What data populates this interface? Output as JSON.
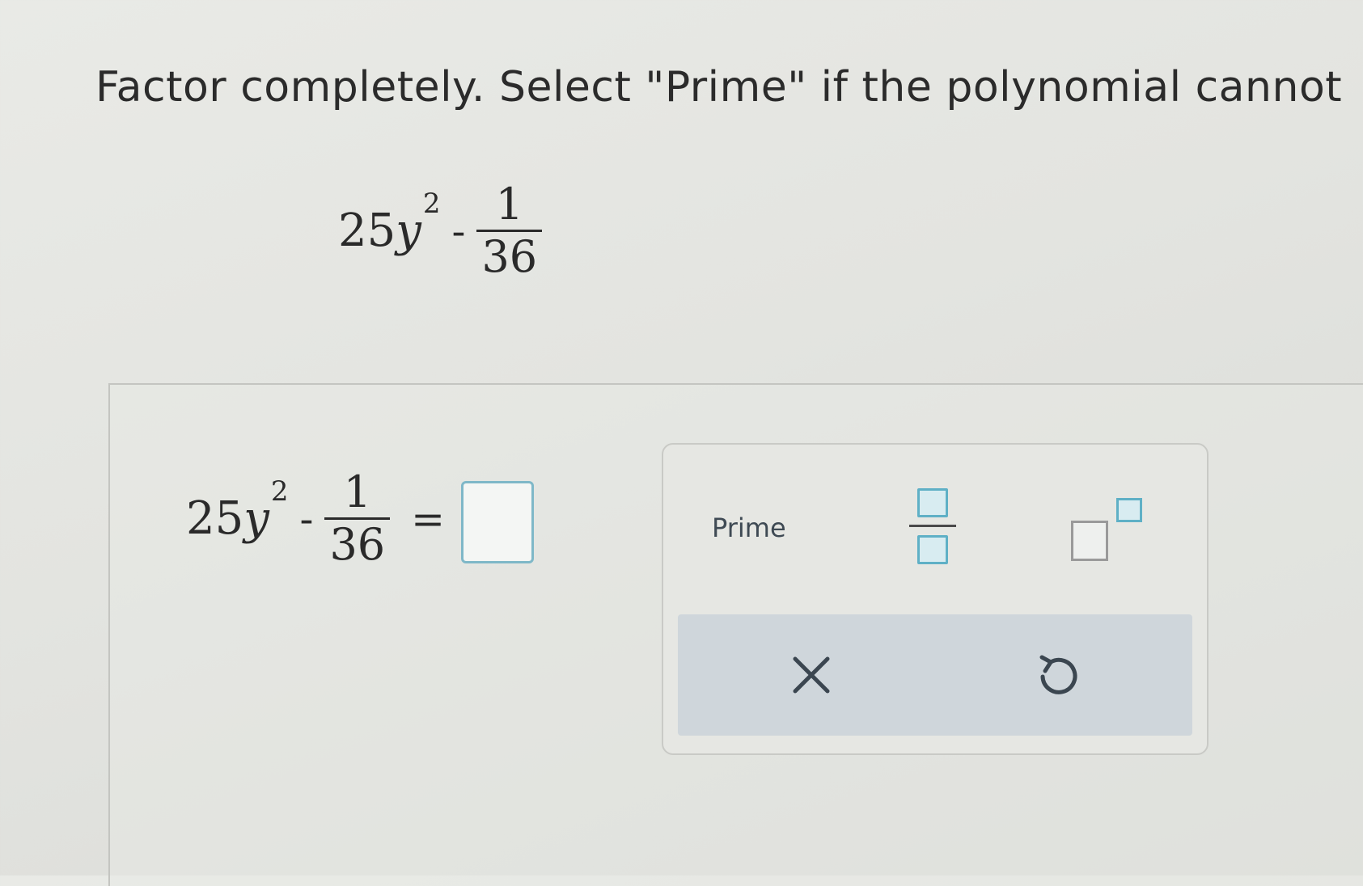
{
  "question": {
    "prompt": "Factor completely. Select \"Prime\" if the polynomial cannot",
    "expression": {
      "coefficient": "25",
      "variable": "y",
      "exponent": "2",
      "operator": "-",
      "numerator": "1",
      "denominator": "36"
    }
  },
  "answer": {
    "coefficient": "25",
    "variable": "y",
    "exponent": "2",
    "operator": "-",
    "numerator": "1",
    "denominator": "36",
    "equals": "=",
    "input_value": ""
  },
  "toolbox": {
    "prime_label": "Prime",
    "tools": [
      "fraction-template",
      "exponent-template",
      "clear",
      "undo"
    ]
  },
  "colors": {
    "accent": "#5fb0c6",
    "toolbar_bottom": "#cfd6db",
    "background": "#e3e4e0"
  }
}
